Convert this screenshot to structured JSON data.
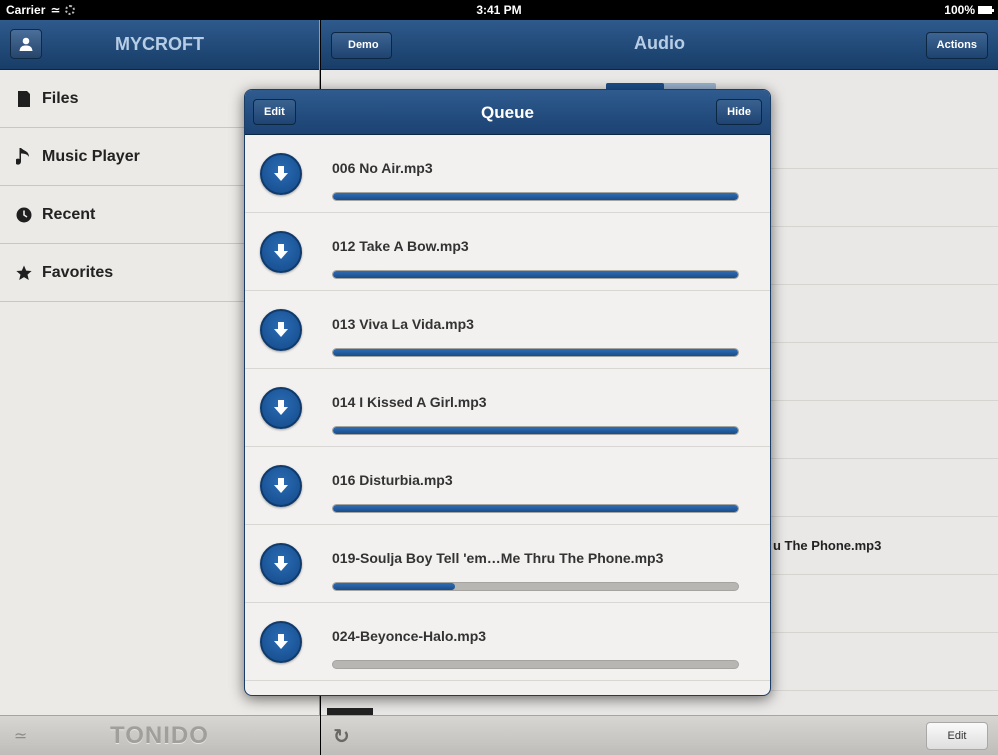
{
  "status_bar": {
    "carrier": "Carrier",
    "time": "3:41 PM",
    "battery": "100%"
  },
  "sidebar": {
    "title": "MYCROFT",
    "items": [
      {
        "label": "Files",
        "icon": "file-icon"
      },
      {
        "label": "Music Player",
        "icon": "music-note-icon"
      },
      {
        "label": "Recent",
        "icon": "clock-icon"
      },
      {
        "label": "Favorites",
        "icon": "star-icon"
      }
    ],
    "footer_logo": "TONIDO"
  },
  "main": {
    "title": "Audio",
    "back_label": "Demo",
    "actions_label": "Actions",
    "background_filename": "u The Phone.mp3",
    "edit_label": "Edit"
  },
  "queue": {
    "title": "Queue",
    "edit_label": "Edit",
    "hide_label": "Hide",
    "items": [
      {
        "name": "006 No Air.mp3",
        "progress": 1.0
      },
      {
        "name": "012 Take A Bow.mp3",
        "progress": 1.0
      },
      {
        "name": "013 Viva La Vida.mp3",
        "progress": 1.0
      },
      {
        "name": "014 I Kissed A Girl.mp3",
        "progress": 1.0
      },
      {
        "name": "016 Disturbia.mp3",
        "progress": 1.0
      },
      {
        "name": "019-Soulja Boy Tell 'em…Me Thru The Phone.mp3",
        "progress": 0.3
      },
      {
        "name": "024-Beyonce-Halo.mp3",
        "progress": 0.0
      }
    ]
  },
  "colors": {
    "accent": "#1a4d8c",
    "navbar": "#1f4474",
    "background": "#e9e8e6"
  }
}
